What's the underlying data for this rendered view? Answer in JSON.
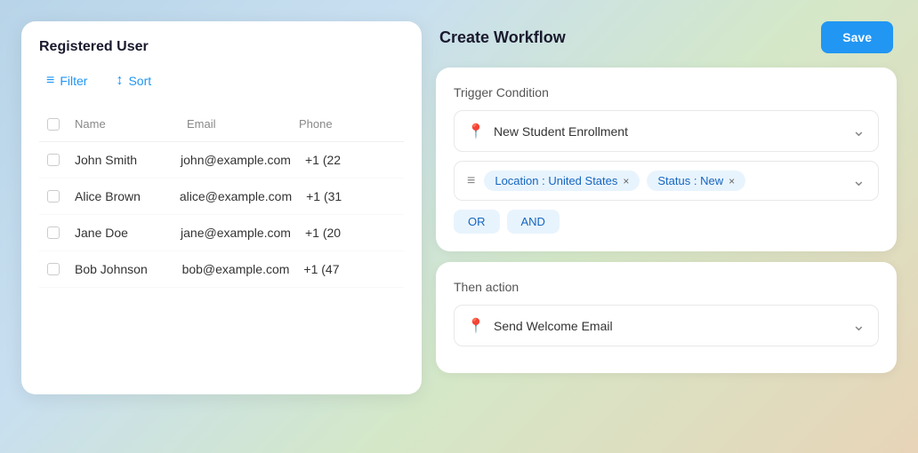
{
  "leftPanel": {
    "title": "Registered User",
    "toolbar": {
      "filter_label": "Filter",
      "sort_label": "Sort"
    },
    "table": {
      "headers": [
        "Name",
        "Email",
        "Phone"
      ],
      "rows": [
        {
          "name": "John Smith",
          "email": "john@example.com",
          "phone": "+1 (22"
        },
        {
          "name": "Alice Brown",
          "email": "alice@example.com",
          "phone": "+1 (31"
        },
        {
          "name": "Jane Doe",
          "email": "jane@example.com",
          "phone": "+1 (20"
        },
        {
          "name": "Bob Johnson",
          "email": "bob@example.com",
          "phone": "+1 (47"
        }
      ]
    }
  },
  "rightPanel": {
    "title": "Create Workflow",
    "save_label": "Save",
    "triggerSection": {
      "label": "Trigger Condition",
      "dropdown_value": "New Student Enrollment",
      "filter_tags": [
        {
          "label": "Location : United States",
          "key": "location"
        },
        {
          "label": "Status : New",
          "key": "status"
        }
      ],
      "logic_or": "OR",
      "logic_and": "AND"
    },
    "actionSection": {
      "label": "Then action",
      "dropdown_value": "Send Welcome Email"
    }
  },
  "icons": {
    "filter": "≡",
    "sort": "↕",
    "pin": "📍",
    "chevron_down": "⌄",
    "filter_lines": "≡",
    "close": "×"
  }
}
